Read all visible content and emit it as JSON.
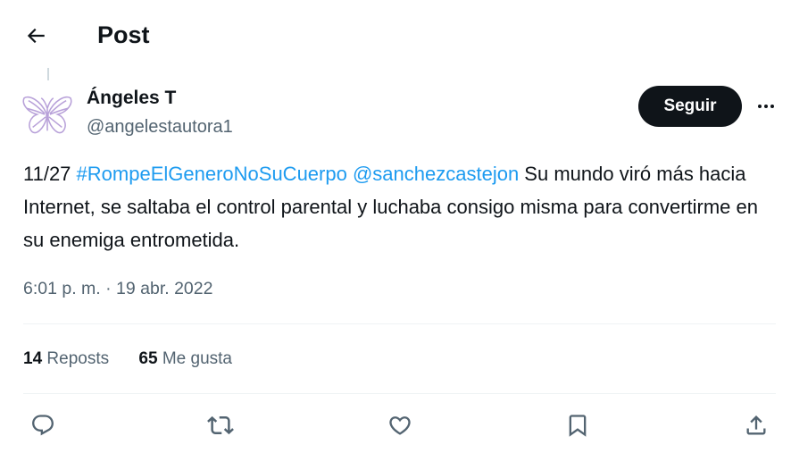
{
  "header": {
    "title": "Post",
    "back_icon": "arrow-left-icon"
  },
  "author": {
    "name": "Ángeles T",
    "handle": "@angelestautora1",
    "avatar_icon": "butterfly-icon",
    "avatar_color": "#b8a1d9"
  },
  "actions_top": {
    "follow_label": "Seguir",
    "more_icon": "more-horizontal-icon"
  },
  "tweet": {
    "prefix": "11/27 ",
    "hashtag": "#RompeElGeneroNoSuCuerpo",
    "space": " ",
    "mention": "@sanchezcastejon",
    "body": " Su mundo viró más hacia Internet, se saltaba el control parental y luchaba consigo misma para convertirme en su enemiga entrometida."
  },
  "timestamp": "6:01 p. m. · 19 abr. 2022",
  "stats": {
    "reposts_count": "14",
    "reposts_label": "Reposts",
    "likes_count": "65",
    "likes_label": "Me gusta"
  },
  "colors": {
    "link": "#1d9bf0",
    "text": "#0f1419",
    "muted": "#536471",
    "follow_bg": "#0f1419"
  },
  "bottom_actions": [
    "reply-icon",
    "repost-icon",
    "like-icon",
    "bookmark-icon",
    "share-icon"
  ]
}
